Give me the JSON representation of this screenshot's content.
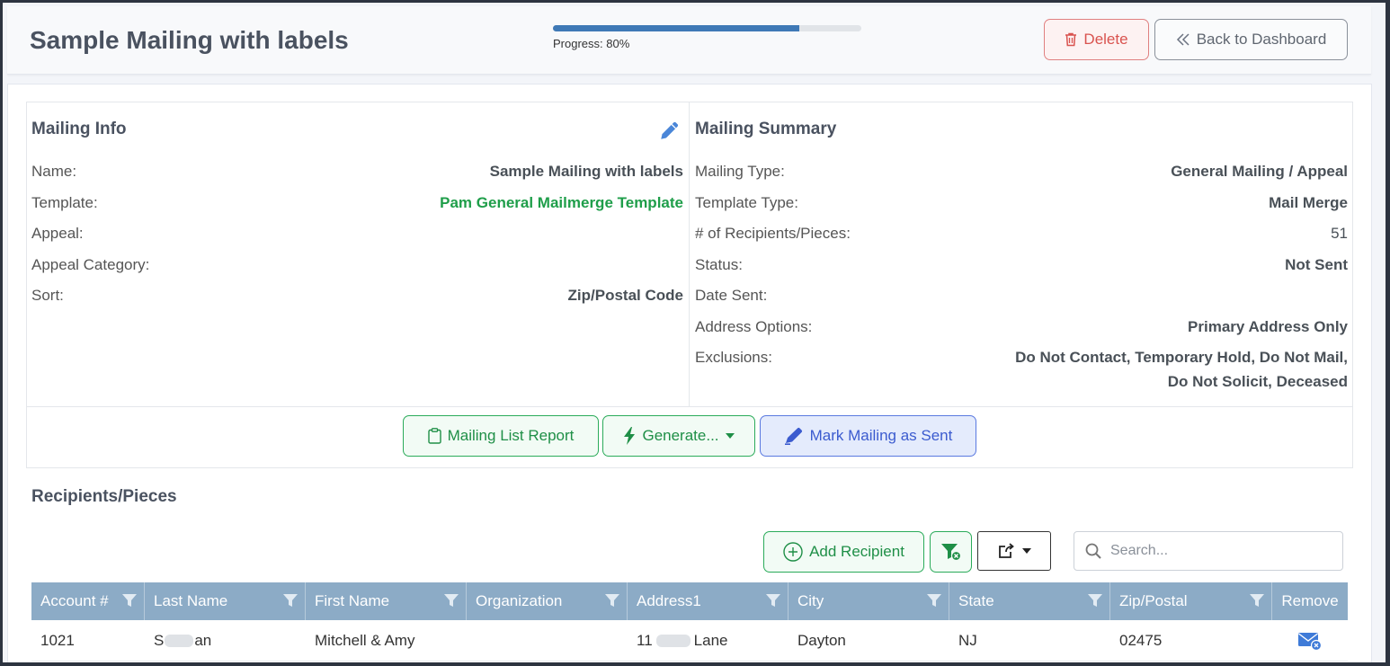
{
  "header": {
    "title": "Sample Mailing with labels",
    "progress_value": 0.8,
    "progress_text": "Progress: 80%",
    "delete_label": "Delete",
    "back_label": "Back to Dashboard"
  },
  "mailing_info": {
    "title": "Mailing Info",
    "rows": [
      {
        "label": "Name:",
        "value": "Sample Mailing with labels"
      },
      {
        "label": "Template:",
        "value": "Pam General Mailmerge Template"
      },
      {
        "label": "Appeal:",
        "value": ""
      },
      {
        "label": "Appeal Category:",
        "value": ""
      },
      {
        "label": "Sort:",
        "value": "Zip/Postal Code"
      }
    ]
  },
  "mailing_summary": {
    "title": "Mailing Summary",
    "rows": [
      {
        "label": "Mailing Type:",
        "value": "General Mailing / Appeal"
      },
      {
        "label": "Template Type:",
        "value": "Mail Merge"
      },
      {
        "label": "# of Recipients/Pieces:",
        "value": "51"
      },
      {
        "label": "Status:",
        "value": "Not Sent"
      },
      {
        "label": "Date Sent:",
        "value": ""
      },
      {
        "label": "Address Options:",
        "value": "Primary Address Only"
      },
      {
        "label": "Exclusions:",
        "value": "Do Not Contact, Temporary Hold, Do Not Mail,",
        "value_line2": "Do Not Solicit, Deceased"
      }
    ]
  },
  "actions": {
    "report_label": "Mailing List Report",
    "generate_label": "Generate...",
    "mark_sent_label": "Mark Mailing as Sent"
  },
  "recipients": {
    "title": "Recipients/Pieces",
    "add_label": "Add Recipient",
    "search_placeholder": "Search...",
    "columns": [
      "Account #",
      "Last Name",
      "First Name",
      "Organization",
      "Address1",
      "City",
      "State",
      "Zip/Postal",
      "Remove"
    ],
    "rows": [
      {
        "account": "1021",
        "last_name_a": "S",
        "last_name_b": "an",
        "first_name": "Mitchell & Amy",
        "organization": "",
        "address_a": "11",
        "address_b": "Lane",
        "city": "Dayton",
        "state": "NJ",
        "zip": "02475"
      }
    ]
  },
  "colors": {
    "accent_blue": "#3f79b6",
    "success_green": "#2bab5a",
    "danger_red": "#d9534f",
    "table_header": "#8cabc6"
  }
}
